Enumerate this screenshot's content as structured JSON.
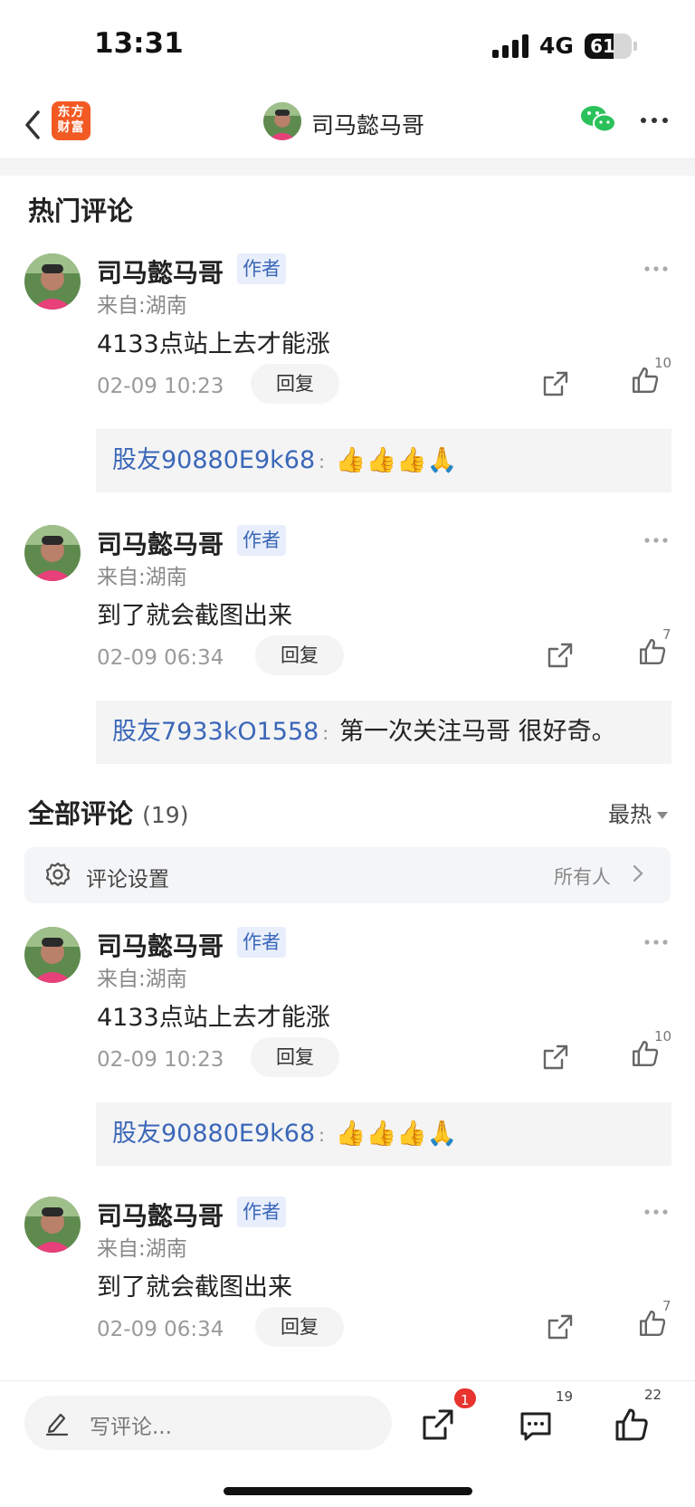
{
  "status_bar": {
    "time": "13:31",
    "network": "4G",
    "battery": "61",
    "battery_level": 0.61
  },
  "nav": {
    "logo_text": "东方财富",
    "title": "司马懿马哥"
  },
  "hot_section": {
    "title": "热门评论"
  },
  "all_section": {
    "title": "全部评论",
    "count": "(19)",
    "sort_label": "最热"
  },
  "settings": {
    "label": "评论设置",
    "value": "所有人"
  },
  "comments": [
    {
      "name": "司马懿马哥",
      "tag": "作者",
      "location": "来自:湖南",
      "body": "4133点站上去才能涨",
      "time": "02-09 10:23",
      "reply_label": "回复",
      "likes": "10",
      "sub_user": "股友90880E9k68",
      "sub_colon": ":",
      "sub_text": "👍👍👍🙏"
    },
    {
      "name": "司马懿马哥",
      "tag": "作者",
      "location": "来自:湖南",
      "body": "到了就会截图出来",
      "time": "02-09 06:34",
      "reply_label": "回复",
      "likes": "7",
      "sub_user": "股友7933kO1558",
      "sub_colon": ":",
      "sub_text": "第一次关注马哥 很好奇。"
    },
    {
      "name": "司马懿马哥",
      "tag": "作者",
      "location": "来自:湖南",
      "body": "4133点站上去才能涨",
      "time": "02-09 10:23",
      "reply_label": "回复",
      "likes": "10",
      "sub_user": "股友90880E9k68",
      "sub_colon": ":",
      "sub_text": "👍👍👍🙏"
    },
    {
      "name": "司马懿马哥",
      "tag": "作者",
      "location": "来自:湖南",
      "body": "到了就会截图出来",
      "time": "02-09 06:34",
      "reply_label": "回复",
      "likes": "7"
    }
  ],
  "bottom_bar": {
    "input_placeholder": "写评论...",
    "share_badge": "1",
    "comment_count": "19",
    "like_count": "22"
  },
  "colors": {
    "brand": "#f25a23",
    "link": "#3b67b8",
    "badge": "#e8332f",
    "wechat": "#2bc15a"
  }
}
